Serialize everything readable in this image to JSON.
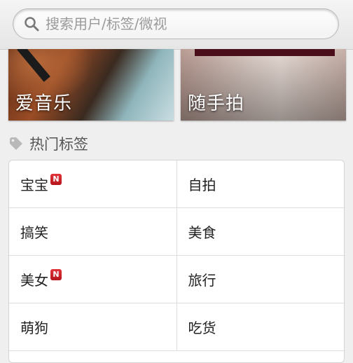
{
  "search": {
    "placeholder": "搜索用户/标签/微视",
    "value": ""
  },
  "banners": [
    {
      "label": "爱音乐"
    },
    {
      "label": "随手拍"
    }
  ],
  "section": {
    "title": "热门标签",
    "icon": "tag-icon"
  },
  "tags": [
    [
      {
        "label": "宝宝",
        "badge": "N"
      },
      {
        "label": "自拍"
      }
    ],
    [
      {
        "label": "搞笑"
      },
      {
        "label": "美食"
      }
    ],
    [
      {
        "label": "美女",
        "badge": "N"
      },
      {
        "label": "旅行"
      }
    ],
    [
      {
        "label": "萌狗"
      },
      {
        "label": "吃货"
      }
    ]
  ],
  "colors": {
    "badge": "#d0252b",
    "text": "#222222",
    "background": "#efefef"
  }
}
